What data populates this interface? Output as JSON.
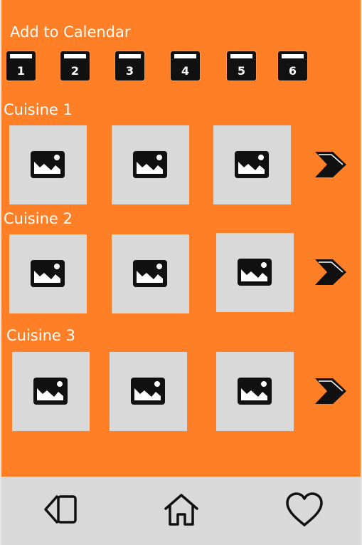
{
  "calendar": {
    "label": "Add to Calendar",
    "days": [
      "1",
      "2",
      "3",
      "4",
      "5",
      "6"
    ]
  },
  "sections": [
    {
      "title": "Cuisine 1"
    },
    {
      "title": "Cuisine 2"
    },
    {
      "title": "Cuisine 3"
    }
  ],
  "colors": {
    "accent": "#ff7f27",
    "tile": "#d9d9d9",
    "icon": "#111111",
    "nav_bg": "#d9d9d9"
  },
  "nav": {
    "icons": [
      "cards-icon",
      "home-icon",
      "heart-icon"
    ]
  }
}
